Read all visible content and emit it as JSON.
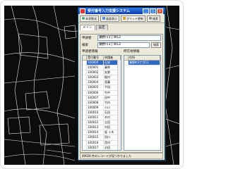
{
  "window": {
    "title": "受付番号入力支援システム",
    "controls": [
      "_",
      "□",
      "×"
    ]
  },
  "toolbar": {
    "buttons": [
      {
        "label": "本状態化",
        "icon": "pin-icon"
      },
      {
        "label": "画面表示",
        "icon": "screen-icon"
      },
      {
        "label": "グリッド更新",
        "icon": "refresh-icon"
      },
      {
        "label": "検索",
        "icon": "search-icon"
      }
    ]
  },
  "tabs": [
    "メイン",
    "設定"
  ],
  "form": {
    "row1": {
      "label": "申請者",
      "value": "瀬野川3丁目12"
    },
    "row2": {
      "label": "検索",
      "value": "瀬野川3丁目12",
      "button": "検索"
    }
  },
  "left_list": {
    "section": "申請者情報",
    "headers": [
      "受付番号",
      "申請者"
    ],
    "rows": [
      [
        "100000",
        "石塚"
      ],
      [
        "100001",
        "藤原"
      ],
      [
        "100002",
        "矢野"
      ],
      [
        "100003",
        "植村"
      ],
      [
        "100004",
        "斎藤"
      ],
      [
        "100005",
        "平田"
      ],
      [
        "100006",
        "竹中"
      ],
      [
        "100007",
        "田中"
      ],
      [
        "100008",
        "竹内"
      ],
      [
        "100009",
        "小川"
      ],
      [
        "100010",
        "石田"
      ],
      [
        "100011",
        "木村"
      ],
      [
        "100012",
        "吉田"
      ],
      [
        "100013",
        "村田"
      ],
      [
        "100014",
        "坂 十木"
      ],
      [
        "100015",
        "田口"
      ],
      [
        "100016",
        "西村"
      ],
      [
        "100017",
        "沢田"
      ],
      [
        "100018",
        "森村"
      ]
    ]
  },
  "right_list": {
    "section": "所在地情報",
    "headers": [
      "住所"
    ],
    "rows": [
      [
        "瀬野町3丁目12"
      ]
    ]
  },
  "status": "40024 件のレコードが見つかりました"
}
